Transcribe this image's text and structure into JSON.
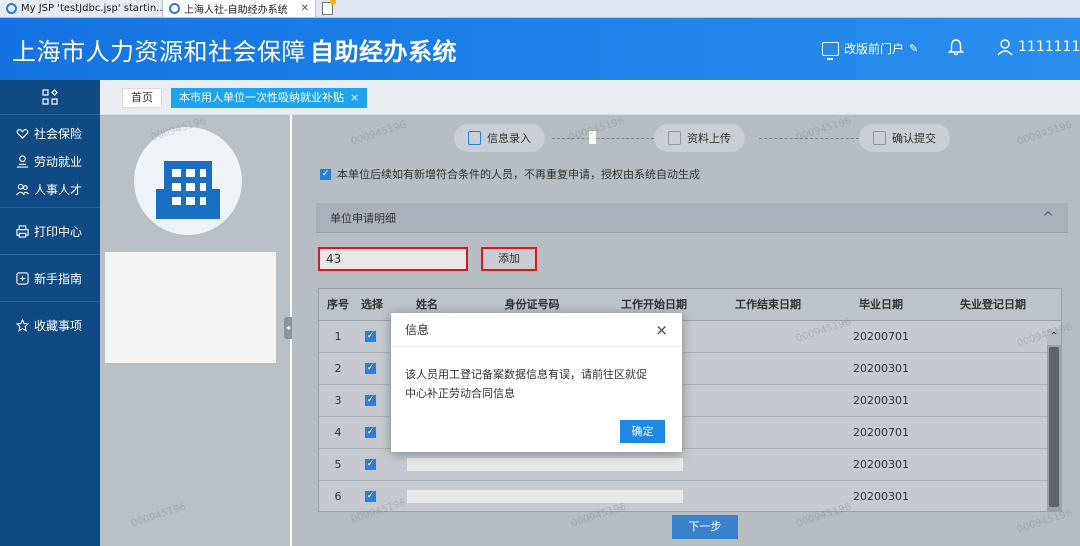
{
  "browser": {
    "tabs": [
      {
        "label": "My JSP 'testJdbc.jsp' startin..."
      },
      {
        "label": "上海人社-自助经办系统"
      }
    ]
  },
  "header": {
    "title_main": "上海市人力资源和社会保障",
    "title_bold": "自助经办系统",
    "portal_link": "改版前门户",
    "user_id": "11111111"
  },
  "sidebar": {
    "items": [
      {
        "label": "社会保险",
        "icon": "heart-hands-icon"
      },
      {
        "label": "劳动就业",
        "icon": "person-badge-icon"
      },
      {
        "label": "人事人才",
        "icon": "people-icon"
      },
      {
        "label": "打印中心",
        "icon": "printer-icon"
      },
      {
        "label": "新手指南",
        "icon": "guide-icon"
      },
      {
        "label": "收藏事项",
        "icon": "star-icon"
      }
    ]
  },
  "tabbar": {
    "home": "首页",
    "active": "本市用人单位一次性吸纳就业补贴",
    "close": "×"
  },
  "steps": [
    {
      "label": "信息录入"
    },
    {
      "label": "资料上传"
    },
    {
      "label": "确认提交"
    }
  ],
  "notice": "本单位后续如有新增符合条件的人员，不再重复申请，授权由系统自动生成",
  "section": {
    "title": "单位申请明细",
    "toggle": "^"
  },
  "search": {
    "value": "43",
    "add_label": "添加"
  },
  "table": {
    "headers": [
      "序号",
      "选择",
      "姓名",
      "身份证号码",
      "工作开始日期",
      "工作结束日期",
      "毕业日期",
      "失业登记日期"
    ],
    "rows": [
      {
        "no": "1",
        "grad": "20200701"
      },
      {
        "no": "2",
        "grad": "20200301"
      },
      {
        "no": "3",
        "grad": "20200301"
      },
      {
        "no": "4",
        "grad": "20200701"
      },
      {
        "no": "5",
        "grad": "20200301"
      },
      {
        "no": "6",
        "grad": "20200301"
      }
    ]
  },
  "next_label": "下一步",
  "dialog": {
    "title": "信息",
    "close": "×",
    "message_line1": "该人员用工登记备案数据信息有误，请前往区就促",
    "message_line2": "中心补正劳动合同信息",
    "ok": "确定"
  },
  "watermark": "000945196",
  "colors": {
    "header_blue": "#1a7ce6",
    "sidebar_navy": "#0f4a85",
    "accent_blue": "#1ea4ee",
    "highlight_red": "#e0141c"
  }
}
